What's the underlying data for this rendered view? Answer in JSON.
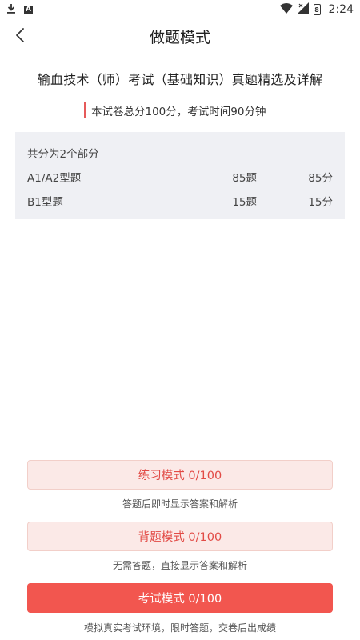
{
  "status_bar": {
    "time": "2:24",
    "battery_glyph": "8"
  },
  "nav": {
    "title": "做题模式"
  },
  "paper": {
    "title": "输血技术（师）考试（基础知识）真题精选及详解",
    "info": "本试卷总分100分，考试时间90分钟",
    "accent_color": "#e65a5a"
  },
  "parts": {
    "header": "共分为2个部分",
    "rows": [
      {
        "name": "A1/A2型题",
        "count": "85题",
        "score": "85分"
      },
      {
        "name": "B1型题",
        "count": "15题",
        "score": "15分"
      }
    ]
  },
  "modes": [
    {
      "label": "练习模式  0/100",
      "description": "答题后即时显示答案和解析",
      "style": "light"
    },
    {
      "label": "背题模式  0/100",
      "description": "无需答题，直接显示答案和解析",
      "style": "light"
    },
    {
      "label": "考试模式  0/100",
      "description": "模拟真实考试环境，限时答题，交卷后出成绩",
      "style": "solid"
    }
  ],
  "colors": {
    "primary": "#f2564f",
    "light_button_bg": "#fbe9e7",
    "parts_bg": "#eff0f4"
  },
  "icons": {
    "back": "chevron-left-icon",
    "download": "download-icon",
    "notification_a": "a-notification-icon",
    "wifi": "wifi-icon",
    "signal": "signal-icon",
    "battery": "battery-icon"
  }
}
